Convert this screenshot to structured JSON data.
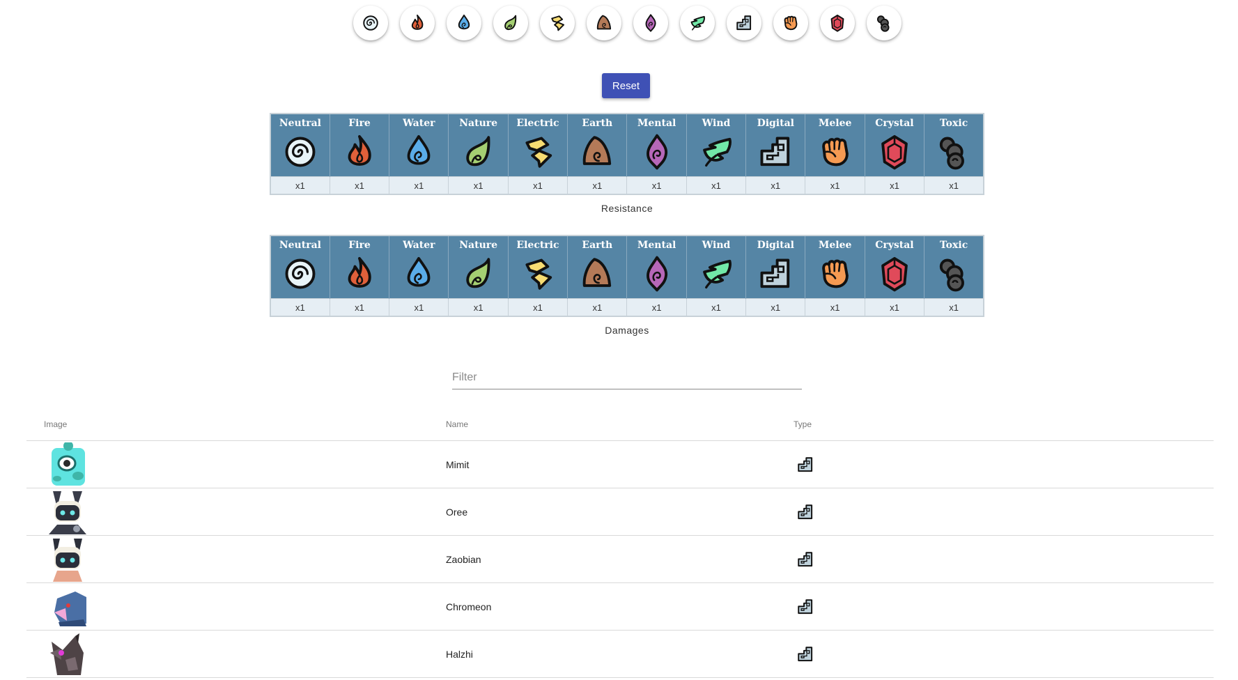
{
  "types": [
    {
      "name": "Neutral",
      "icon": "neutral-icon",
      "color": "#e8f4f8"
    },
    {
      "name": "Fire",
      "icon": "fire-icon",
      "color": "#e0603a"
    },
    {
      "name": "Water",
      "icon": "water-icon",
      "color": "#5aace8"
    },
    {
      "name": "Nature",
      "icon": "nature-icon",
      "color": "#a5cf72"
    },
    {
      "name": "Electric",
      "icon": "electric-icon",
      "color": "#f7dc72"
    },
    {
      "name": "Earth",
      "icon": "earth-icon",
      "color": "#b47a58"
    },
    {
      "name": "Mental",
      "icon": "mental-icon",
      "color": "#b667b8"
    },
    {
      "name": "Wind",
      "icon": "wind-icon",
      "color": "#72e8a8"
    },
    {
      "name": "Digital",
      "icon": "digital-icon",
      "color": "#bfd2dc"
    },
    {
      "name": "Melee",
      "icon": "melee-icon",
      "color": "#f59a52"
    },
    {
      "name": "Crystal",
      "icon": "crystal-icon",
      "color": "#e04a5a"
    },
    {
      "name": "Toxic",
      "icon": "toxic-icon",
      "color": "#555555"
    }
  ],
  "reset_label": "Reset",
  "resistance": {
    "caption": "Resistance",
    "values": [
      "x1",
      "x1",
      "x1",
      "x1",
      "x1",
      "x1",
      "x1",
      "x1",
      "x1",
      "x1",
      "x1",
      "x1"
    ]
  },
  "damages": {
    "caption": "Damages",
    "values": [
      "x1",
      "x1",
      "x1",
      "x1",
      "x1",
      "x1",
      "x1",
      "x1",
      "x1",
      "x1",
      "x1",
      "x1"
    ]
  },
  "filter": {
    "placeholder": "Filter",
    "value": ""
  },
  "monster_table": {
    "headers": {
      "image": "Image",
      "name": "Name",
      "type": "Type"
    },
    "rows": [
      {
        "name": "Mimit",
        "type": "Digital",
        "type_icon": "digital-icon"
      },
      {
        "name": "Oree",
        "type": "Digital",
        "type_icon": "digital-icon"
      },
      {
        "name": "Zaobian",
        "type": "Digital",
        "type_icon": "digital-icon"
      },
      {
        "name": "Chromeon",
        "type": "Digital",
        "type_icon": "digital-icon"
      },
      {
        "name": "Halzhi",
        "type": "Digital",
        "type_icon": "digital-icon"
      }
    ]
  },
  "colors": {
    "accent": "#3f51b5",
    "header_bg": "#5585a5",
    "cell_bg": "#e6eef4"
  }
}
